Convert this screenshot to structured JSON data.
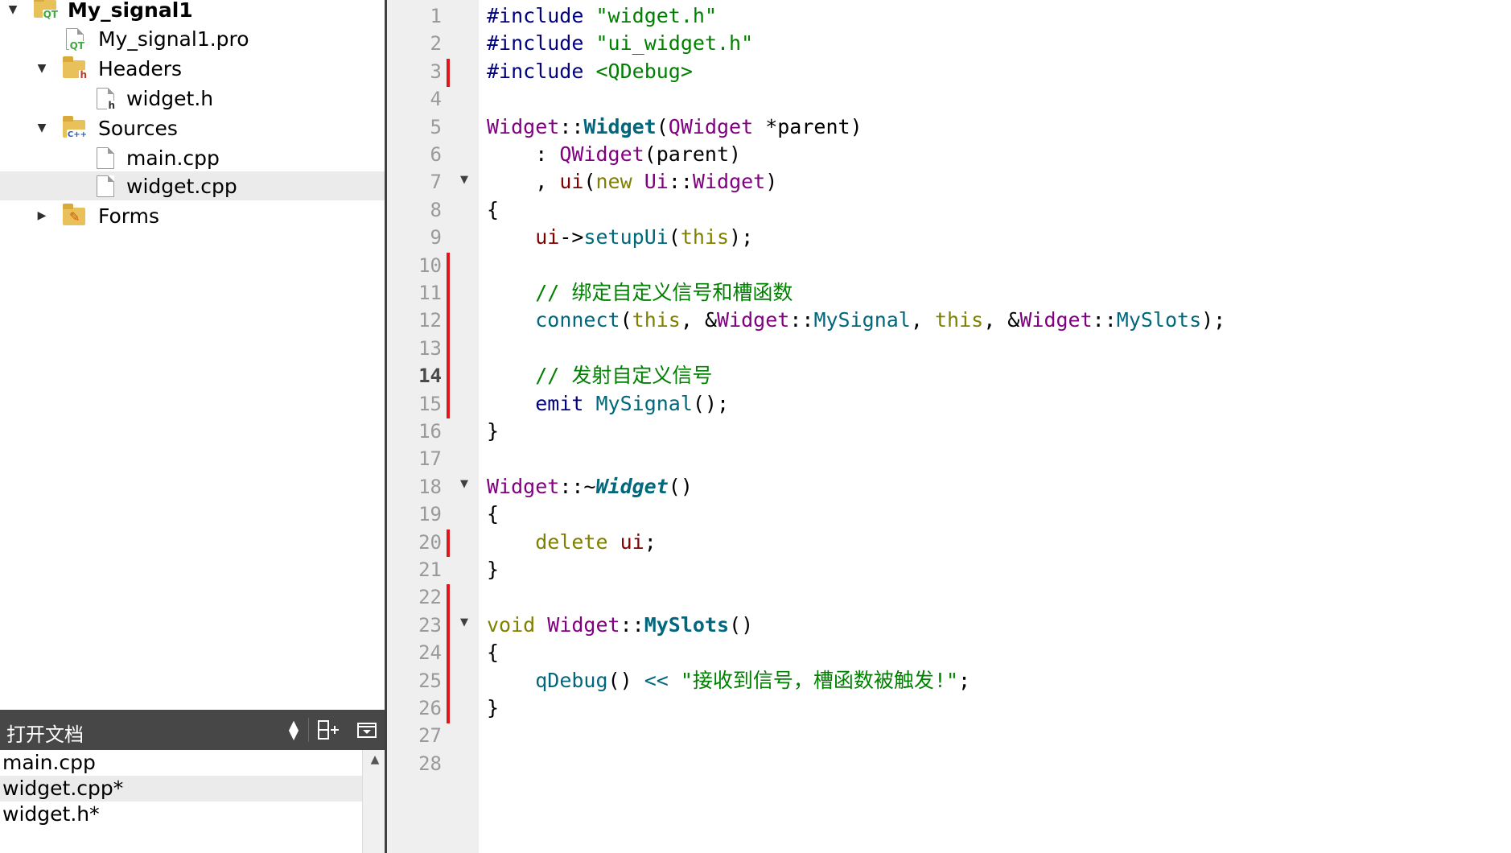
{
  "project_tree": {
    "items": [
      {
        "label": "My_signal1",
        "icon": "qt-project-folder-icon",
        "badge": "QT",
        "bold": true,
        "arrow": "expanded"
      },
      {
        "label": "My_signal1.pro",
        "icon": "qt-pro-file-icon",
        "badge": "QT"
      },
      {
        "label": "Headers",
        "icon": "headers-folder-icon",
        "badge": "h",
        "arrow": "expanded"
      },
      {
        "label": "widget.h",
        "icon": "header-file-icon",
        "badge": "h"
      },
      {
        "label": "Sources",
        "icon": "sources-folder-icon",
        "badge": "C++",
        "arrow": "expanded"
      },
      {
        "label": "main.cpp",
        "icon": "cpp-file-icon"
      },
      {
        "label": "widget.cpp",
        "icon": "cpp-file-icon",
        "selected": true
      },
      {
        "label": "Forms",
        "icon": "forms-folder-icon",
        "arrow": "collapsed"
      }
    ]
  },
  "open_documents": {
    "title": "打开文档",
    "items": [
      {
        "label": "main.cpp"
      },
      {
        "label": "widget.cpp*",
        "selected": true
      },
      {
        "label": "widget.h*"
      }
    ]
  },
  "editor": {
    "current_line": 14,
    "line_numbers": [
      "1",
      "2",
      "3",
      "4",
      "5",
      "6",
      "7",
      "8",
      "9",
      "10",
      "11",
      "12",
      "13",
      "14",
      "15",
      "16",
      "17",
      "18",
      "19",
      "20",
      "21",
      "22",
      "23",
      "24",
      "25",
      "26",
      "27",
      "28"
    ],
    "changed_lines": [
      3,
      10,
      11,
      12,
      13,
      14,
      15,
      20,
      22,
      23,
      24,
      25,
      26
    ],
    "fold_lines": [
      7,
      18,
      23
    ],
    "code": {
      "l1_pp": "#include",
      "l1_str": "\"widget.h\"",
      "l2_pp": "#include",
      "l2_str": "\"ui_widget.h\"",
      "l3_pp": "#include",
      "l3_str": "<QDebug>",
      "l5_cls": "Widget",
      "l5_sep": "::",
      "l5_fn": "Widget",
      "l5_p1": "(",
      "l5_type": "QWidget",
      "l5_arg": " *parent",
      "l5_p2": ")",
      "l6_colon": "    : ",
      "l6_cls": "QWidget",
      "l6_args": "(parent)",
      "l7_comma": "    , ",
      "l7_mem": "ui",
      "l7_p1": "(",
      "l7_kw": "new",
      "l7_sp": " ",
      "l7_ns": "Ui",
      "l7_sep": "::",
      "l7_cls": "Widget",
      "l7_p2": ")",
      "l8": "{",
      "l9_ind": "    ",
      "l9_mem": "ui",
      "l9_arrow": "->",
      "l9_fn": "setupUi",
      "l9_p1": "(",
      "l9_kw": "this",
      "l9_p2": ");",
      "l11_ind": "    ",
      "l11_cm": "// 绑定自定义信号和槽函数",
      "l12_ind": "    ",
      "l12_fn": "connect",
      "l12_p1": "(",
      "l12_kw1": "this",
      "l12_c1": ", &",
      "l12_cls1": "Widget",
      "l12_sep1": "::",
      "l12_fn1": "MySignal",
      "l12_c2": ", ",
      "l12_kw2": "this",
      "l12_c3": ", &",
      "l12_cls2": "Widget",
      "l12_sep2": "::",
      "l12_fn2": "MySlots",
      "l12_p2": ");",
      "l14_ind": "    ",
      "l14_cm": "// 发射自定义信号",
      "l15_ind": "    ",
      "l15_kw": "emit",
      "l15_sp": " ",
      "l15_fn": "MySignal",
      "l15_p": "();",
      "l16": "}",
      "l18_cls": "Widget",
      "l18_sep": "::~",
      "l18_fn": "Widget",
      "l18_p": "()",
      "l19": "{",
      "l20_ind": "    ",
      "l20_kw": "delete",
      "l20_sp": " ",
      "l20_mem": "ui",
      "l20_p": ";",
      "l21": "}",
      "l23_kw": "void",
      "l23_sp": " ",
      "l23_cls": "Widget",
      "l23_sep": "::",
      "l23_fn": "MySlots",
      "l23_p": "()",
      "l24": "{",
      "l25_ind": "    ",
      "l25_fn": "qDebug",
      "l25_p": "() ",
      "l25_op": "<<",
      "l25_sp": " ",
      "l25_str": "\"接收到信号，槽函数被触发!\"",
      "l25_end": ";",
      "l26": "}"
    }
  },
  "colors": {
    "preprocessor": "#000080",
    "string": "#008000",
    "class": "#800080",
    "function": "#00677c",
    "keyword": "#808000",
    "member": "#800000",
    "comment": "#008000",
    "change_marker": "#e0161b",
    "panel_header": "#474747"
  }
}
